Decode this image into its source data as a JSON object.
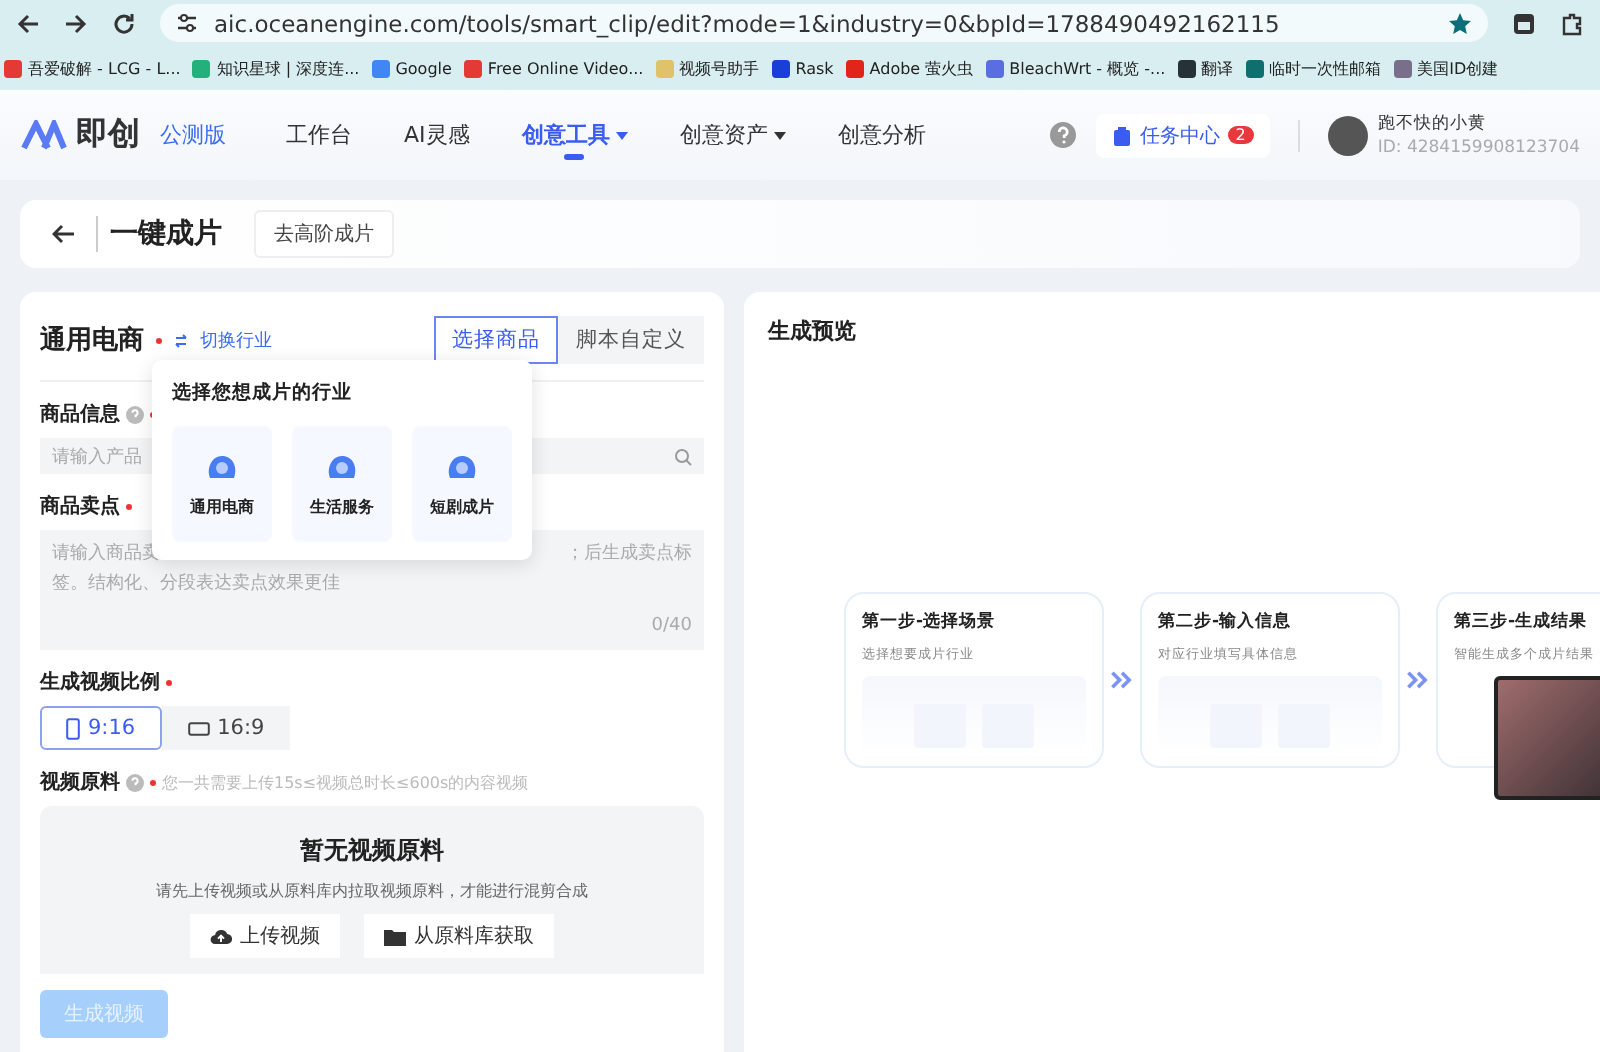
{
  "browser": {
    "url": "aic.oceanengine.com/tools/smart_clip/edit?mode=1&industry=0&bpId=1788490492162115",
    "bookmarks": [
      {
        "label": "吾爱破解 - LCG - L...",
        "color": "#e53935"
      },
      {
        "label": "知识星球 | 深度连...",
        "color": "#22b07d"
      },
      {
        "label": "Google",
        "color": "#4285f4"
      },
      {
        "label": "Free Online Video...",
        "color": "#e53935"
      },
      {
        "label": "视频号助手",
        "color": "#e0c26a"
      },
      {
        "label": "Rask",
        "color": "#1a3fd6"
      },
      {
        "label": "Adobe 萤火虫",
        "color": "#e1251b"
      },
      {
        "label": "BleachWrt - 概览 -...",
        "color": "#5b6ee1"
      },
      {
        "label": "翻译",
        "color": "#263238"
      },
      {
        "label": "临时一次性邮箱",
        "color": "#0f6e6e"
      },
      {
        "label": "美国ID创建",
        "color": "#7a6f8a"
      }
    ]
  },
  "header": {
    "logo": "即创",
    "edition": "公测版",
    "nav": [
      {
        "label": "工作台",
        "selected": false,
        "dropdown": false
      },
      {
        "label": "AI灵感",
        "selected": false,
        "dropdown": false
      },
      {
        "label": "创意工具",
        "selected": true,
        "dropdown": true
      },
      {
        "label": "创意资产",
        "selected": false,
        "dropdown": true
      },
      {
        "label": "创意分析",
        "selected": false,
        "dropdown": false
      }
    ],
    "task_center": {
      "label": "任务中心",
      "badge": "2"
    },
    "user": {
      "name": "跑不快的小黄",
      "id": "ID: 4284159908123704"
    }
  },
  "page": {
    "title": "一键成片",
    "advanced_button": "去高阶成片"
  },
  "form": {
    "industry": "通用电商",
    "switch_link": "切换行业",
    "tabs": [
      {
        "label": "选择商品",
        "selected": true
      },
      {
        "label": "脚本自定义",
        "selected": false
      }
    ],
    "product_info": {
      "label": "商品信息",
      "placeholder": "请输入产品"
    },
    "selling_points": {
      "label": "商品卖点",
      "placeholder_parts": [
        "请输入商品卖",
        "；后生成卖点标",
        "签。结构化、分段表达卖点效果更佳"
      ],
      "counter": "0/40"
    },
    "ratio": {
      "label": "生成视频比例",
      "options": [
        {
          "label": "9:16",
          "kind": "portrait",
          "selected": true
        },
        {
          "label": "16:9",
          "kind": "landscape",
          "selected": false
        }
      ]
    },
    "footage": {
      "label": "视频原料",
      "hint": "您一共需要上传15s≤视频总时长≤600s的内容视频",
      "empty_title": "暂无视频原料",
      "empty_text": "请先上传视频或从原料库内拉取视频原料，才能进行混剪合成",
      "buttons": [
        {
          "label": "上传视频",
          "kind": "upload"
        },
        {
          "label": "从原料库获取",
          "kind": "library"
        }
      ]
    },
    "generate_button": {
      "label": "生成视频",
      "disabled": true
    }
  },
  "industry_popup": {
    "title": "选择您想成片的行业",
    "options": [
      {
        "label": "通用电商"
      },
      {
        "label": "生活服务"
      },
      {
        "label": "短剧成片"
      }
    ]
  },
  "preview": {
    "title": "生成预览",
    "steps": [
      {
        "title": "第一步-选择场景",
        "text": "选择想要成片行业",
        "kind": "scene"
      },
      {
        "title": "第二步-输入信息",
        "text": "对应行业填写具体信息",
        "kind": "info"
      },
      {
        "title": "第三步-生成结果",
        "text": "智能生成多个成片结果",
        "kind": "result"
      }
    ]
  }
}
